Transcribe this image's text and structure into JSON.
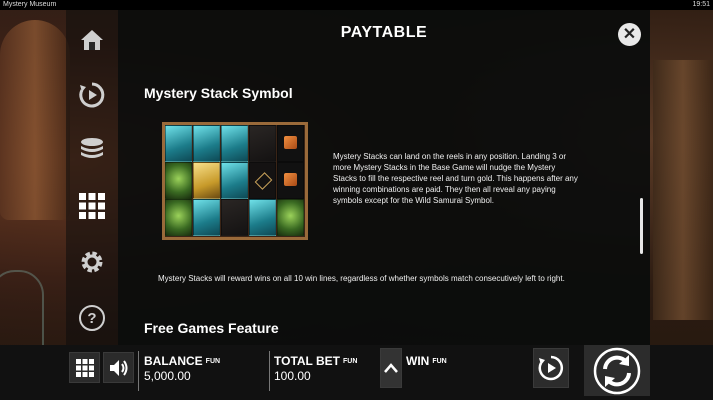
{
  "window": {
    "title": "Mystery Museum",
    "clock": "19:51"
  },
  "menu": [
    {
      "name": "home-icon"
    },
    {
      "name": "autoplay-icon"
    },
    {
      "name": "coins-icon"
    },
    {
      "name": "paytable-grid-icon"
    },
    {
      "name": "gear-icon"
    },
    {
      "name": "help-icon"
    }
  ],
  "paytable": {
    "title": "PAYTABLE",
    "close_label": "✕",
    "mystery_stack": {
      "heading": "Mystery Stack Symbol",
      "description": "Mystery Stacks can land on the reels in any position. Landing 3 or more Mystery Stacks in the Base Game will nudge the Mystery Stacks to fill the respective reel and turn gold. This happens after any winning combinations are paid. They then all reveal any paying symbols except for the Wild Samurai Symbol.",
      "note": "Mystery Stacks will reward wins on all 10 win lines, regardless of whether symbols match consecutively left to right."
    },
    "free_games": {
      "heading": "Free Games Feature"
    }
  },
  "bottom": {
    "balance_label": "BALANCE",
    "balance_fun": "FUN",
    "balance_value": "5,000.00",
    "total_bet_label": "TOTAL BET",
    "total_bet_fun": "FUN",
    "total_bet_value": "100.00",
    "win_label": "WIN",
    "win_fun": "FUN"
  }
}
